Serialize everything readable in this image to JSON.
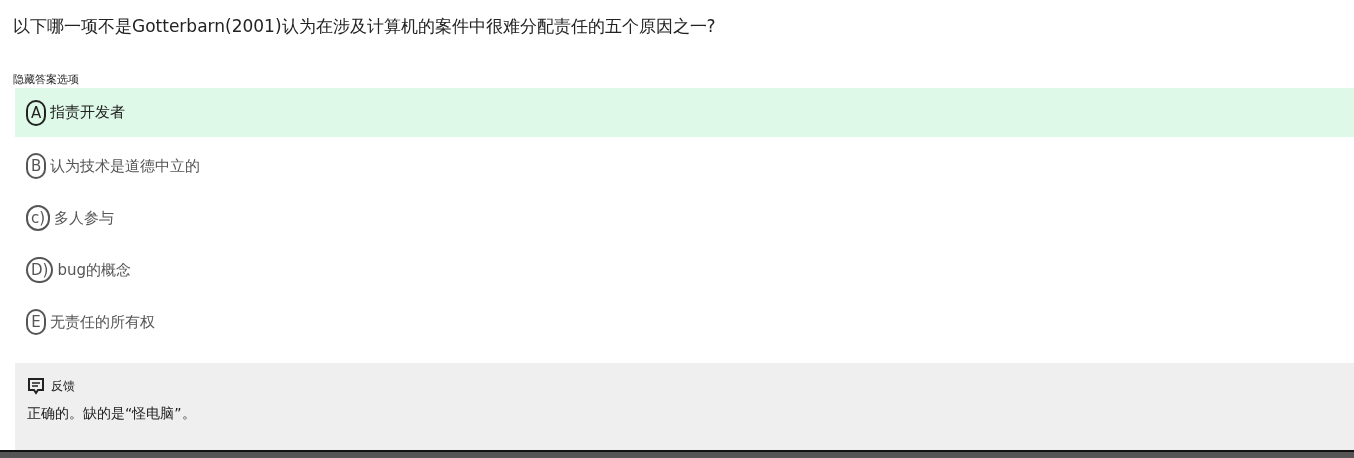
{
  "question": "以下哪一项不是Gotterbarn(2001)认为在涉及计算机的案件中很难分配责任的五个原因之一?",
  "hide_answers_link": "隐藏答案选项",
  "options": [
    {
      "letter": "A",
      "text": "指责开发者",
      "selected": true
    },
    {
      "letter": "B",
      "text": "认为技术是道德中立的",
      "selected": false
    },
    {
      "letter": "c)",
      "text": "多人参与",
      "selected": false
    },
    {
      "letter": "D)",
      "text": "bug的概念",
      "selected": false
    },
    {
      "letter": "E",
      "text": "无责任的所有权",
      "selected": false
    }
  ],
  "feedback": {
    "title": "反馈",
    "text": "正确的。缺的是“怪电脑”。"
  }
}
